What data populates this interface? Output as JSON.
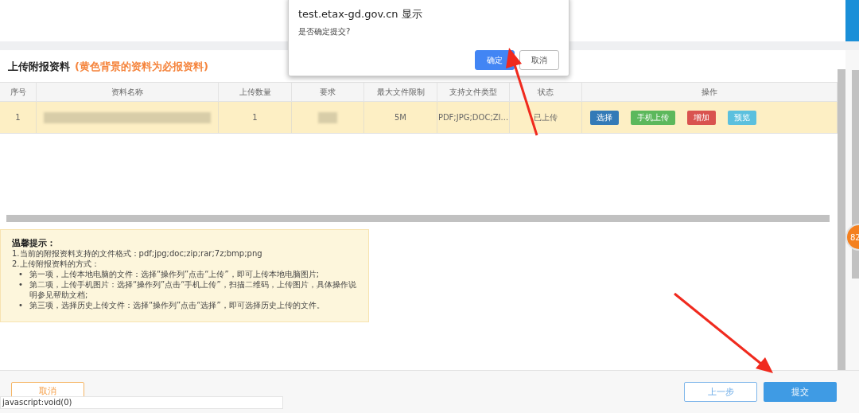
{
  "dialog": {
    "title": "test.etax-gd.gov.cn 显示",
    "message": "是否确定提交?",
    "buttons": [
      {
        "label": "确定",
        "kind": "primary"
      },
      {
        "label": "取消",
        "kind": "secondary"
      }
    ]
  },
  "section": {
    "title": "上传附报资料",
    "note": "(黄色背景的资料为必报资料)"
  },
  "table": {
    "columns": [
      "序号",
      "资料名称",
      "上传数量",
      "要求",
      "最大文件限制",
      "支持文件类型",
      "状态",
      "操作"
    ],
    "rows": [
      {
        "required": true,
        "cells": [
          {
            "kind": "text",
            "text": "1"
          },
          {
            "kind": "blurred"
          },
          {
            "kind": "text",
            "text": "1"
          },
          {
            "kind": "blurred"
          },
          {
            "kind": "text",
            "text": "5M"
          },
          {
            "kind": "text",
            "text": "PDF;JPG;DOC;ZI..."
          },
          {
            "kind": "text",
            "text": "已上传"
          },
          {
            "kind": "actions",
            "buttons": [
              {
                "label": "选择",
                "color": "#337ab7"
              },
              {
                "label": "手机上传",
                "color": "#5cb85c"
              },
              {
                "label": "增加",
                "color": "#d9534f"
              },
              {
                "label": "预览",
                "color": "#5bc0de"
              }
            ]
          }
        ]
      }
    ]
  },
  "tips": {
    "title": "温馨提示：",
    "lines": [
      "1.当前的附报资料支持的文件格式：pdf;jpg;doc;zip;rar;7z;bmp;png",
      "2.上传附报资料的方式："
    ],
    "bullets": [
      {
        "marker": "•",
        "text": "第一项，上传本地电脑的文件：选择“操作列”点击“上传”，即可上传本地电脑图片;"
      },
      {
        "marker": "•",
        "text": "第二项，上传手机图片：选择“操作列”点击“手机上传”，扫描二维码，上传图片，具体操作说明参见帮助文档;"
      },
      {
        "marker": "•",
        "text": "第三项，选择历史上传文件：选择“操作列”点击“选择”，即可选择历史上传的文件。"
      }
    ]
  },
  "footer": {
    "cancel": "取消",
    "prev": "上一步",
    "submit": "提交"
  },
  "badge": "82",
  "status_text": "javascript:void(0)"
}
